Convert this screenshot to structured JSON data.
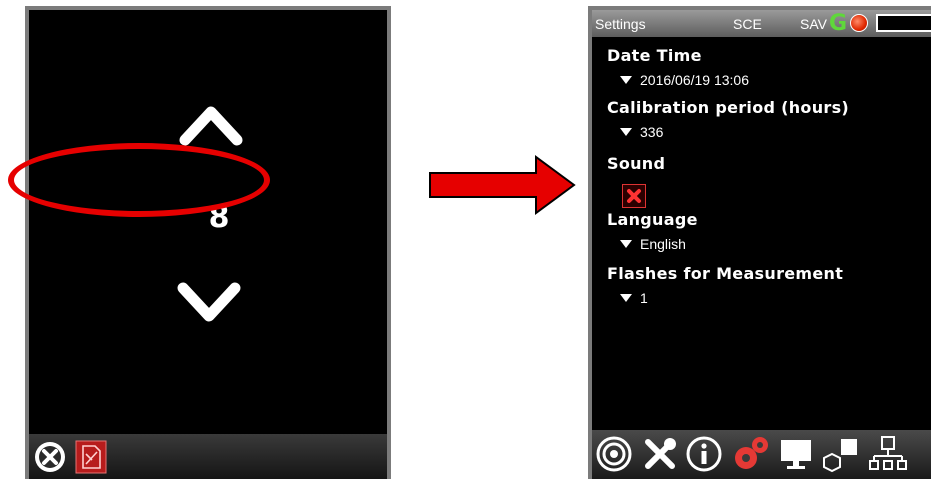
{
  "left_device": {
    "value": "8",
    "up_icon": "chevron-up-icon",
    "down_icon": "chevron-down-icon",
    "bottom_icons": [
      "close-circle-icon",
      "document-icon"
    ]
  },
  "right_device": {
    "status_bar": {
      "title": "Settings",
      "mode": "SCE",
      "save": "SAV",
      "status_letter": "G"
    },
    "settings": [
      {
        "label": "Date Time",
        "value": "2016/06/19 13:06"
      },
      {
        "label": "Calibration period (hours)",
        "value": "336"
      },
      {
        "label": "Sound",
        "checkbox": "unchecked"
      },
      {
        "label": "Language",
        "value": "English"
      },
      {
        "label": "Flashes for Measurement",
        "value": "1"
      }
    ],
    "bottom_icons": [
      "target-icon",
      "tools-icon",
      "info-icon",
      "gears-icon",
      "monitor-icon",
      "shapes-icon",
      "network-icon"
    ]
  },
  "colors": {
    "highlight": "#e60000",
    "arrow": "#e60000",
    "status_green": "#5fd83a"
  }
}
